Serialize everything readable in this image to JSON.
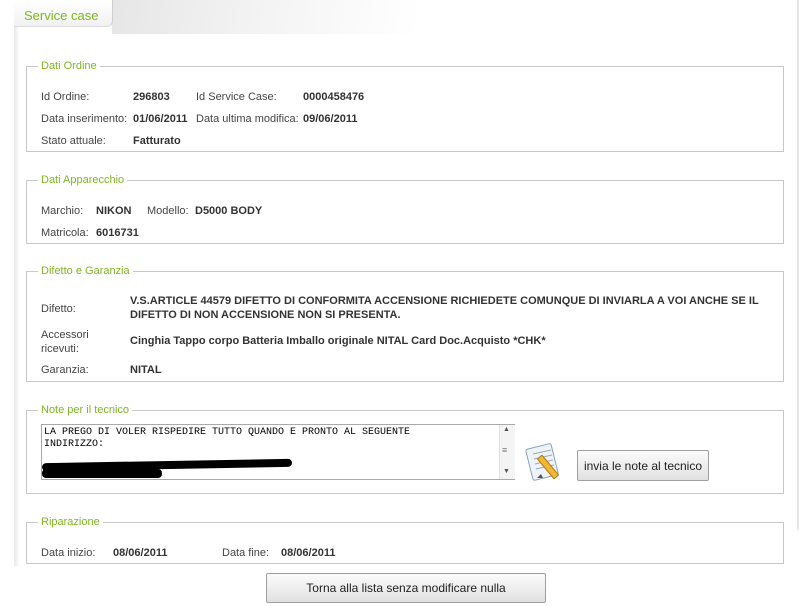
{
  "tab": {
    "title": "Service case"
  },
  "dati_ordine": {
    "legend": "Dati Ordine",
    "id_ordine_label": "Id Ordine:",
    "id_ordine": "296803",
    "id_service_case_label": "Id Service Case:",
    "id_service_case": "0000458476",
    "data_inserimento_label": "Data inserimento:",
    "data_inserimento": "01/06/2011",
    "data_ultima_modifica_label": "Data ultima modifica:",
    "data_ultima_modifica": "09/06/2011",
    "stato_label": "Stato attuale:",
    "stato": "Fatturato"
  },
  "dati_apparecchio": {
    "legend": "Dati Apparecchio",
    "marchio_label": "Marchio:",
    "marchio": "NIKON",
    "modello_label": "Modello:",
    "modello": "D5000 BODY",
    "matricola_label": "Matricola:",
    "matricola": "6016731"
  },
  "difetto_garanzia": {
    "legend": "Difetto e Garanzia",
    "difetto_label": "Difetto:",
    "difetto_line1": "V.S.ARTICLE 44579 DIFETTO DI CONFORMITA ACCENSIONE RICHIEDETE COMUNQUE DI INVIARLA A VOI ANCHE SE IL",
    "difetto_line2": "DIFETTO DI NON ACCENSIONE NON SI PRESENTA.",
    "accessori_label_1": "Accessori",
    "accessori_label_2": "ricevuti:",
    "accessori": "Cinghia Tappo corpo Batteria Imballo originale NITAL Card Doc.Acquisto *CHK*",
    "garanzia_label": "Garanzia:",
    "garanzia": "NITAL"
  },
  "note_tecnico": {
    "legend": "Note per il tecnico",
    "text": "LA PREGO DI VOLER RISPEDIRE TUTTO QUANDO E PRONTO AL SEGUENTE\nINDIRIZZO:",
    "button_label": "invia le note al tecnico"
  },
  "riparazione": {
    "legend": "Riparazione",
    "data_inizio_label": "Data inizio:",
    "data_inizio": "08/06/2011",
    "data_fine_label": "Data fine:",
    "data_fine": "08/06/2011"
  },
  "footer": {
    "back_button_label": "Torna alla lista senza modificare nulla"
  },
  "colors": {
    "accent": "#7fb522",
    "border": "#c8c8c8"
  },
  "icons": {
    "notes": "notepad-pencil-icon",
    "scroll_up": "scroll-up-icon",
    "scroll_down": "scroll-down-icon"
  }
}
